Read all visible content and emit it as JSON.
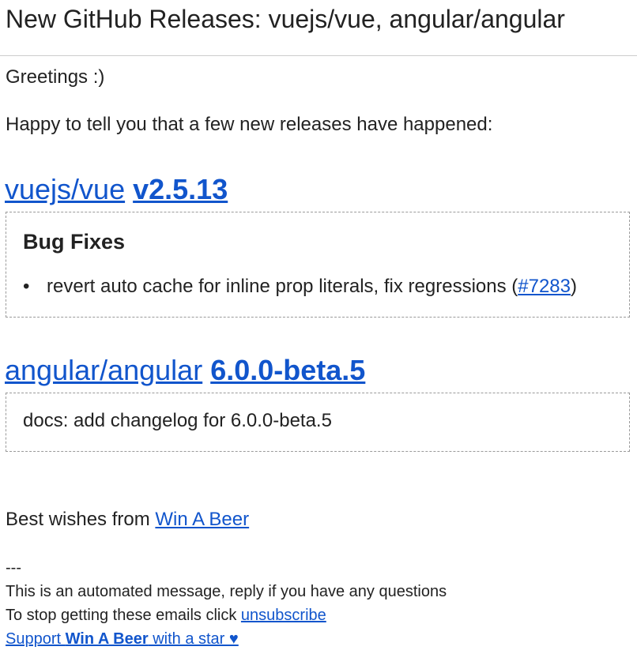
{
  "email": {
    "subject": "New GitHub Releases: vuejs/vue, angular/angular",
    "greeting": "Greetings :)",
    "intro": "Happy to tell you that a few new releases have happened:",
    "releases": [
      {
        "repo": "vuejs/vue",
        "version": "v2.5.13",
        "section_title": "Bug Fixes",
        "items": [
          {
            "text": "revert auto cache for inline prop literals, fix regressions (",
            "link": "#7283",
            "suffix": ")"
          }
        ]
      },
      {
        "repo": "angular/angular",
        "version": "6.0.0-beta.5",
        "note": "docs: add changelog for 6.0.0-beta.5"
      }
    ],
    "signoff_prefix": "Best wishes from ",
    "signoff_link": "Win A Beer",
    "separator": "---",
    "automated_note": "This is an automated message, reply if you have any questions",
    "unsubscribe_prefix": "To stop getting these emails click ",
    "unsubscribe_link": "unsubscribe",
    "support_prefix": "Support ",
    "support_name": "Win A Beer",
    "support_suffix": " with a star ♥"
  },
  "colors": {
    "link": "#1155cc",
    "text": "#222222",
    "divider": "#cccccc",
    "box_border": "#9a9a9a"
  }
}
